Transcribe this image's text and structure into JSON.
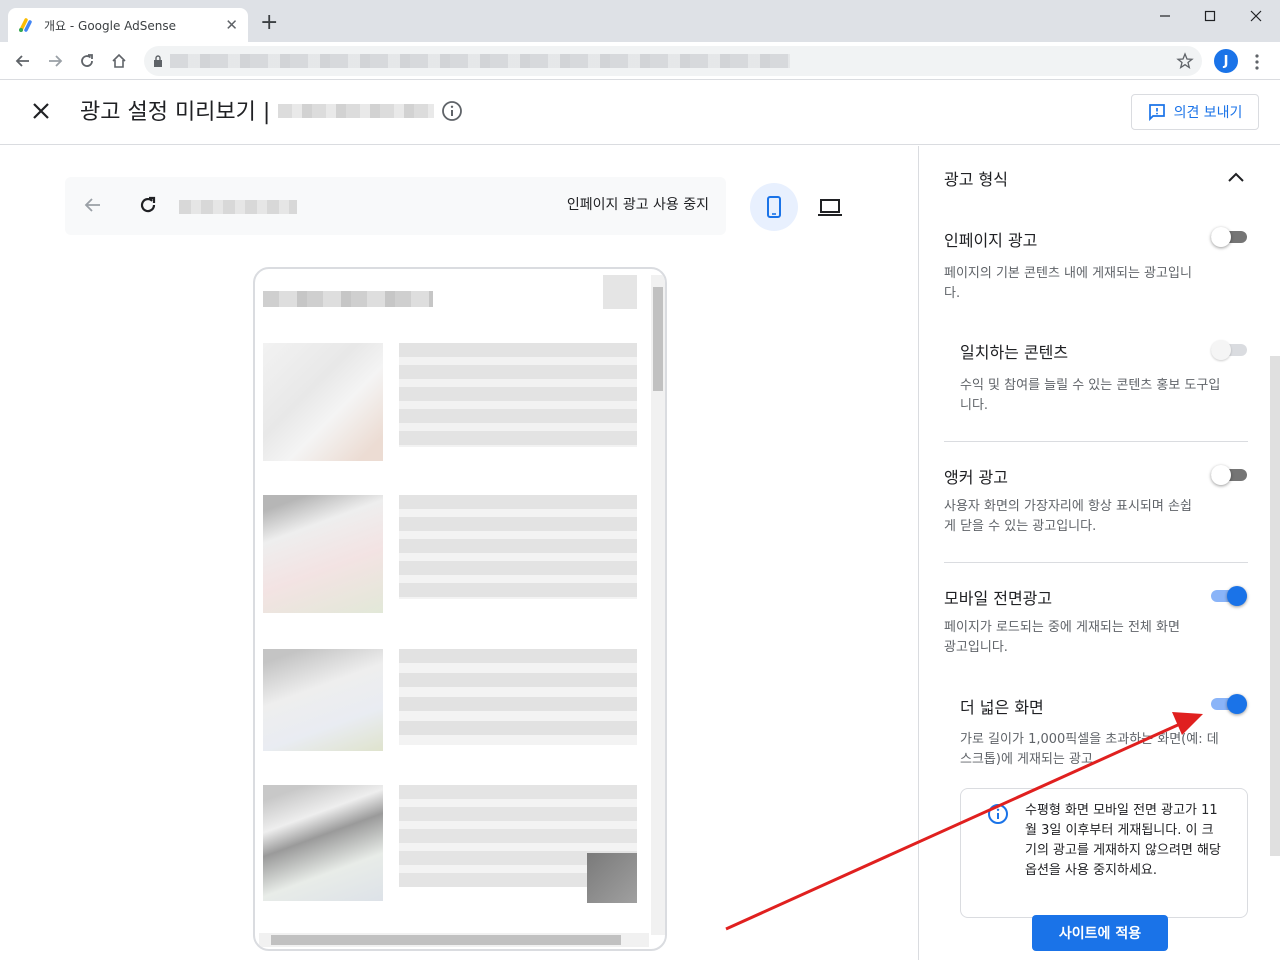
{
  "browser": {
    "tab_title": "개요 - Google AdSense",
    "tab_close": "✕",
    "new_tab": "+",
    "avatar_initial": "J"
  },
  "header": {
    "title": "광고 설정 미리보기 |",
    "feedback_label": "의견 보내기"
  },
  "preview": {
    "stop_inpage_label": "인페이지 광고 사용 중지",
    "selected_device": "mobile"
  },
  "panel": {
    "section_title": "광고 형식",
    "options": [
      {
        "title": "인페이지 광고",
        "desc": "페이지의 기본 콘텐츠 내에 게재되는 광고입니다.",
        "enabled": false
      },
      {
        "title": "일치하는 콘텐츠",
        "desc": "수익 및 참여를 늘릴 수 있는 콘텐츠 홍보 도구입니다.",
        "enabled": false,
        "disabled": true
      },
      {
        "title": "앵커 광고",
        "desc": "사용자 화면의 가장자리에 항상 표시되며 손쉽게 닫을 수 있는 광고입니다.",
        "enabled": false
      },
      {
        "title": "모바일 전면광고",
        "desc": "페이지가 로드되는 중에 게재되는 전체 화면 광고입니다.",
        "enabled": true
      },
      {
        "title": "더 넓은 화면",
        "desc": "가로 길이가 1,000픽셀을 초과하는 화면(예: 데스크톱)에 게재되는 광고",
        "enabled": true
      }
    ],
    "notice": "수평형 화면 모바일 전면 광고가 11월 3일 이후부터 게재됩니다. 이 크기의 광고를 게재하지 않으려면 해당 옵션을 사용 중지하세요.",
    "apply_label": "사이트에 적용"
  },
  "colors": {
    "accent": "#1a73e8",
    "annotation_arrow": "#e0201f"
  }
}
